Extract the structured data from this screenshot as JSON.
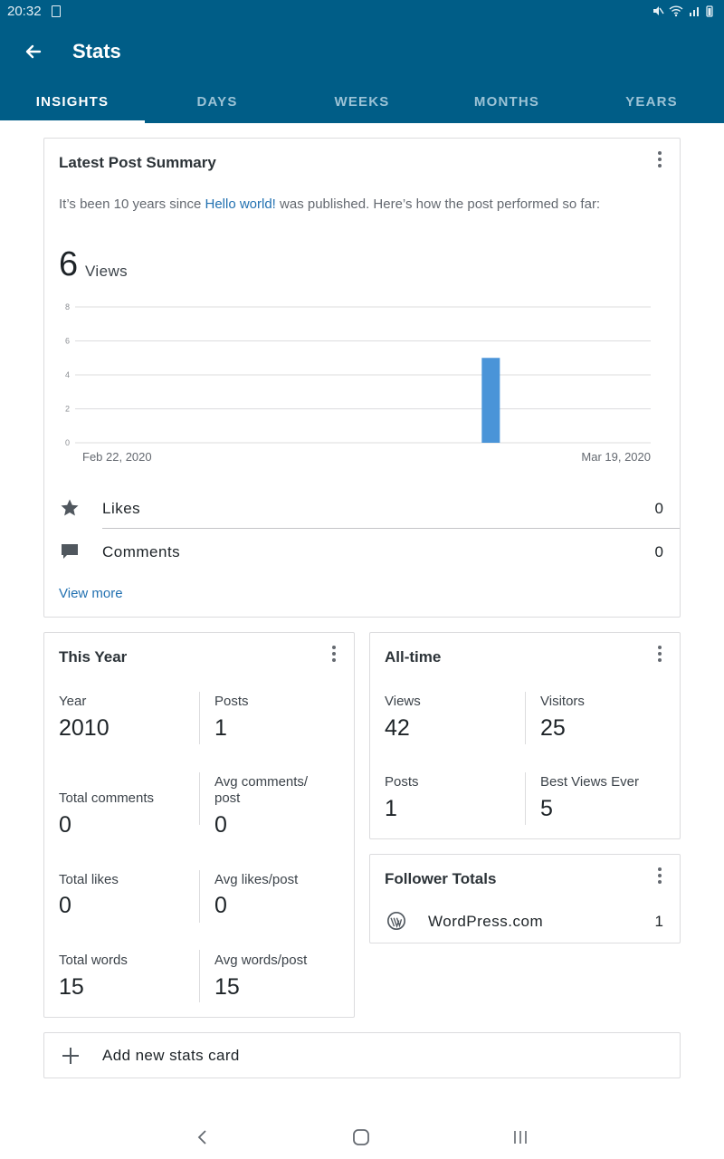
{
  "status_bar": {
    "time": "20:32"
  },
  "app_bar": {
    "title": "Stats"
  },
  "tabs": [
    {
      "label": "INSIGHTS",
      "active": true
    },
    {
      "label": "DAYS",
      "active": false
    },
    {
      "label": "WEEKS",
      "active": false
    },
    {
      "label": "MONTHS",
      "active": false
    },
    {
      "label": "YEARS",
      "active": false
    }
  ],
  "latest_post": {
    "title": "Latest Post Summary",
    "summary_prefix": "It’s been 10 years since ",
    "post_link": "Hello world!",
    "summary_suffix": " was published. Here’s how the post performed so far:",
    "views_count": "6",
    "views_label": "Views",
    "likes_label": "Likes",
    "likes_value": "0",
    "comments_label": "Comments",
    "comments_value": "0",
    "view_more": "View more"
  },
  "chart_data": {
    "type": "bar",
    "x_start_label": "Feb 22, 2020",
    "x_end_label": "Mar 19, 2020",
    "y_ticks": [
      0,
      2,
      4,
      6,
      8
    ],
    "ylim": [
      0,
      8
    ],
    "num_days": 27,
    "values": [
      0,
      0,
      0,
      0,
      0,
      0,
      0,
      0,
      0,
      0,
      0,
      0,
      0,
      0,
      0,
      0,
      0,
      0,
      0,
      5,
      0,
      0,
      0,
      0,
      0,
      0,
      0
    ],
    "bar_color": "#4a94d8",
    "grid": true
  },
  "this_year": {
    "title": "This Year",
    "stats": [
      {
        "label": "Year",
        "value": "2010"
      },
      {
        "label": "Posts",
        "value": "1"
      },
      {
        "label": "Total comments",
        "value": "0"
      },
      {
        "label": "Avg comments/\npost",
        "value": "0"
      },
      {
        "label": "Total likes",
        "value": "0"
      },
      {
        "label": "Avg likes/post",
        "value": "0"
      },
      {
        "label": "Total words",
        "value": "15"
      },
      {
        "label": "Avg words/post",
        "value": "15"
      }
    ]
  },
  "all_time": {
    "title": "All-time",
    "stats": [
      {
        "label": "Views",
        "value": "42"
      },
      {
        "label": "Visitors",
        "value": "25"
      },
      {
        "label": "Posts",
        "value": "1"
      },
      {
        "label": "Best Views Ever",
        "value": "5"
      }
    ]
  },
  "follower_totals": {
    "title": "Follower Totals",
    "source": "WordPress.com",
    "count": "1"
  },
  "add_card": {
    "label": "Add new stats card"
  },
  "colors": {
    "primary": "#005d87",
    "link": "#2271b1",
    "bar": "#4a94d8"
  }
}
